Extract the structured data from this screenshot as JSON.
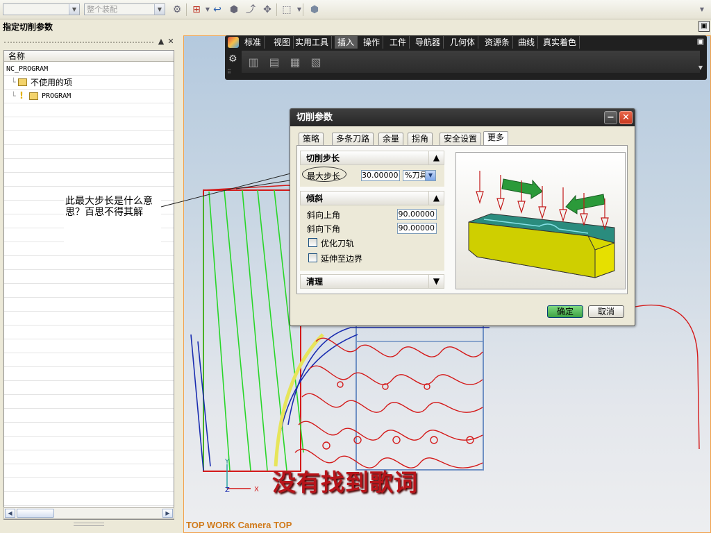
{
  "toolbar": {
    "combo1_value": "",
    "combo2_value": "整个装配"
  },
  "panel_title": "指定切削参数",
  "navigator": {
    "column_header": "名称",
    "rows": [
      {
        "label": "NC_PROGRAM"
      },
      {
        "label": "不使用的项"
      },
      {
        "label": "PROGRAM"
      }
    ]
  },
  "ribbon": {
    "tabs": [
      "标准",
      "视图",
      "实用工具",
      "插入",
      "操作",
      "工件",
      "导航器",
      "几何体",
      "资源条",
      "曲线",
      "真实着色"
    ],
    "active_tab": "插入"
  },
  "dialog": {
    "title": "切削参数",
    "tabs": [
      "策略",
      "多条刀路",
      "余量",
      "拐角",
      "安全设置",
      "更多"
    ],
    "active_tab": "更多",
    "sections": {
      "cut_step": {
        "title": "切削步长",
        "max_step_label": "最大步长",
        "max_step_value": "30.00000",
        "max_step_unit": "%刀具"
      },
      "tilt": {
        "title": "倾斜",
        "ramp_up_label": "斜向上角",
        "ramp_up_value": "90.00000",
        "ramp_down_label": "斜向下角",
        "ramp_down_value": "90.00000",
        "optimize_label": "优化刀轨",
        "optimize_checked": false,
        "extend_label": "延伸至边界",
        "extend_checked": false
      },
      "cleanup": {
        "title": "清理"
      }
    },
    "ok_label": "确定",
    "cancel_label": "取消"
  },
  "annotation": {
    "text": "此最大步长是什么意思？百思不得其解"
  },
  "overlay_text": "没有找到歌词",
  "viewport_label": "TOP WORK Camera TOP",
  "axis": {
    "y": "Y",
    "z": "Z",
    "x": "X"
  },
  "colors": {
    "dialog_title_bg": "#262626",
    "close_button": "#c8381f",
    "ok_button": "#3fa244",
    "toolpath_green": "#29d629",
    "toolpath_red": "#d41a1a",
    "toolpath_blue": "#1a2db0",
    "viewport_label": "#d07a1a"
  }
}
